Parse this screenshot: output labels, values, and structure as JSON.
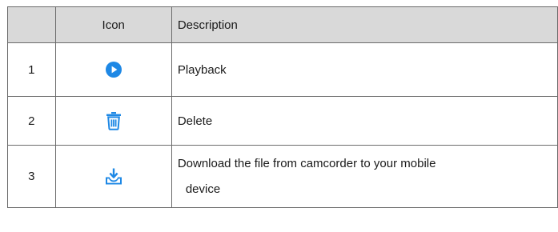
{
  "table": {
    "header": {
      "number": "",
      "icon": "Icon",
      "description": "Description"
    },
    "rows": [
      {
        "number": "1",
        "icon": "play-icon",
        "description": "Playback"
      },
      {
        "number": "2",
        "icon": "trash-icon",
        "description": "Delete"
      },
      {
        "number": "3",
        "icon": "download-tray-icon",
        "description_line1": "Download the file from camcorder to your mobile",
        "description_line2": "device"
      }
    ]
  },
  "colors": {
    "accent": "#1e88e5",
    "header_bg": "#d9d9d9",
    "border": "#6b6b6b"
  }
}
